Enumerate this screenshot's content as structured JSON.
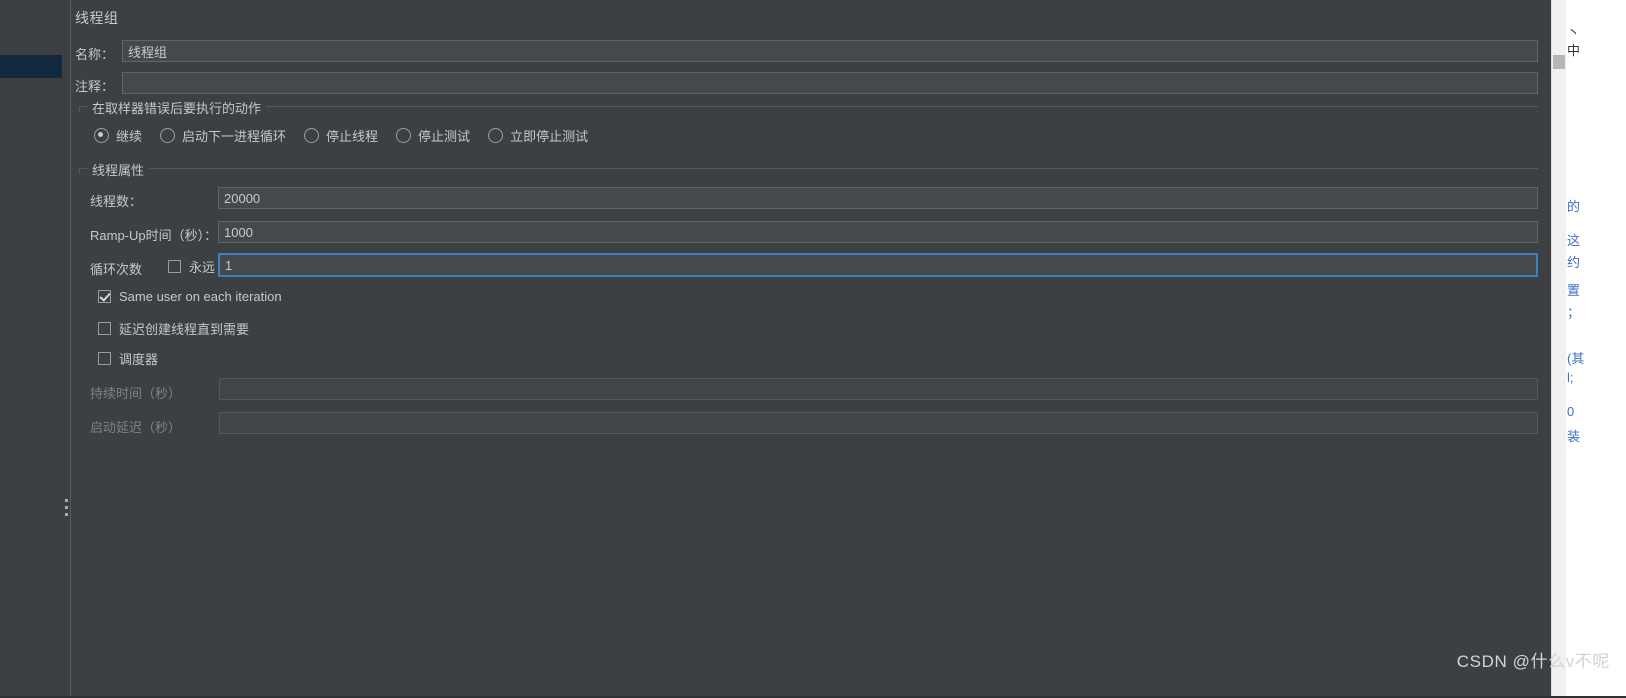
{
  "panel": {
    "title": "线程组",
    "name_label": "名称：",
    "name_value": "线程组",
    "comment_label": "注释：",
    "comment_value": "",
    "comment_placeholder": ""
  },
  "error_action": {
    "group_title": "在取样器错误后要执行的动作",
    "options": [
      {
        "label": "继续",
        "selected": true
      },
      {
        "label": "启动下一进程循环",
        "selected": false
      },
      {
        "label": "停止线程",
        "selected": false
      },
      {
        "label": "停止测试",
        "selected": false
      },
      {
        "label": "立即停止测试",
        "selected": false
      }
    ]
  },
  "thread_properties": {
    "group_title": "线程属性",
    "threads_label": "线程数：",
    "threads_value": "20000",
    "rampup_label": "Ramp-Up时间（秒）：",
    "rampup_value": "1000",
    "loops_label": "循环次数",
    "forever_label": "永远",
    "forever_checked": false,
    "loops_value": "1",
    "same_user_label": "Same user on each iteration",
    "same_user_checked": true,
    "delay_create_label": "延迟创建线程直到需要",
    "delay_create_checked": false,
    "scheduler_label": "调度器",
    "scheduler_checked": false,
    "duration_label": "持续时间（秒）",
    "duration_value": "",
    "startup_delay_label": "启动延迟（秒）",
    "startup_delay_value": ""
  },
  "background_document": {
    "lines": [
      "丶",
      "中",
      "的",
      "这",
      "约",
      "置",
      "；",
      "(其",
      "l;",
      "0",
      "装"
    ]
  },
  "watermark": {
    "text": "CSDN @什么v不呢"
  },
  "colors": {
    "panel_bg": "#3c4043",
    "field_bg": "#45494c",
    "field_border": "#5f6468",
    "focus_border": "#3e7fc1",
    "text": "#c6c8c9",
    "text_dim": "#7e8284",
    "selection": "#12293d"
  }
}
